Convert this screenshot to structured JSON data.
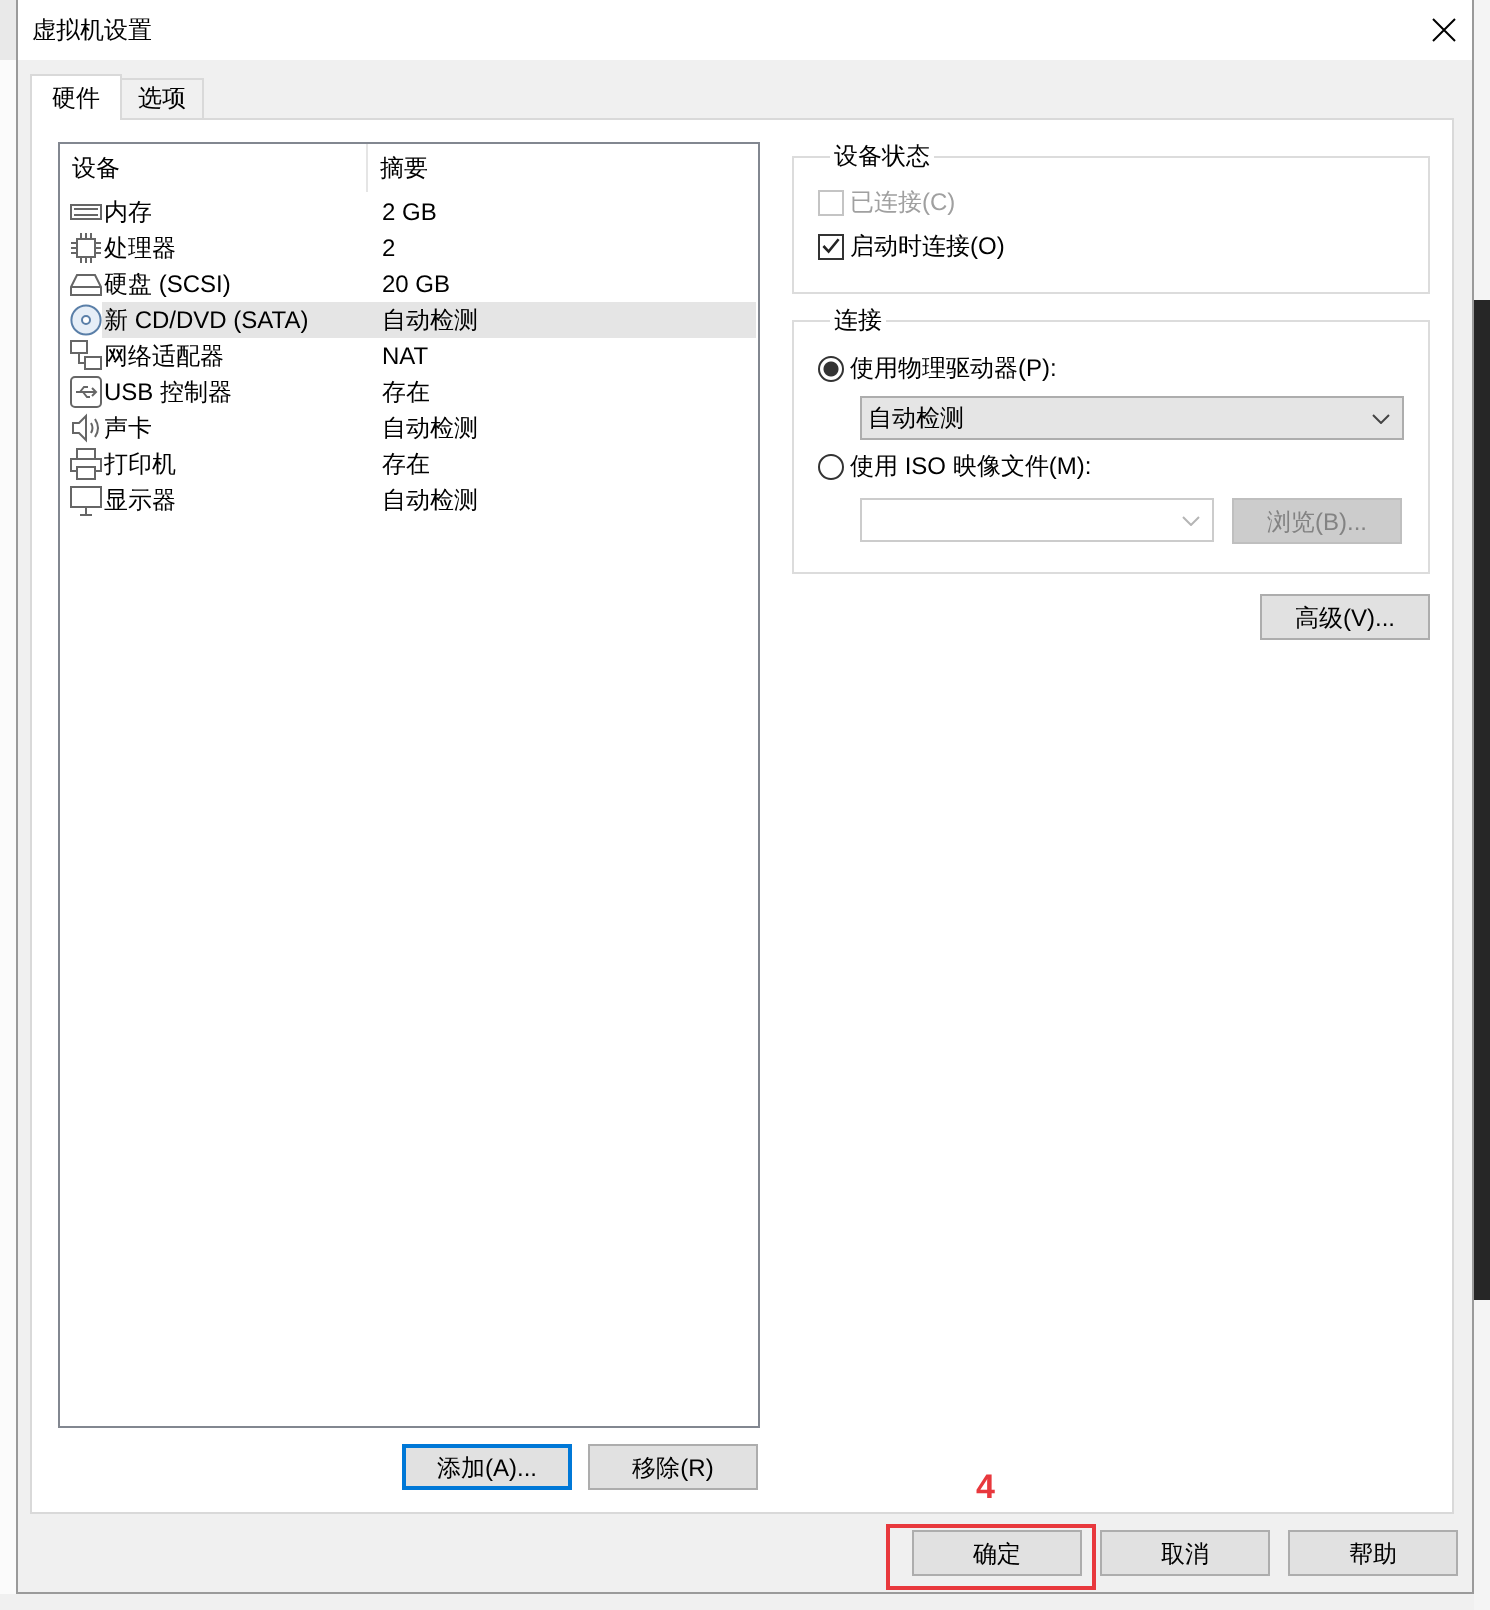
{
  "window": {
    "title": "虚拟机设置"
  },
  "tabs": [
    {
      "label": "硬件",
      "selected": true
    },
    {
      "label": "选项",
      "selected": false
    }
  ],
  "device_list": {
    "columns": [
      "设备",
      "摘要"
    ],
    "rows": [
      {
        "kind": "memory",
        "device": "内存",
        "summary": "2 GB",
        "selected": false
      },
      {
        "kind": "processor",
        "device": "处理器",
        "summary": "2",
        "selected": false
      },
      {
        "kind": "hard_disk",
        "device": "硬盘 (SCSI)",
        "summary": "20 GB",
        "selected": false
      },
      {
        "kind": "cd_dvd",
        "device": "新 CD/DVD (SATA)",
        "summary": "自动检测",
        "selected": true
      },
      {
        "kind": "network",
        "device": "网络适配器",
        "summary": "NAT",
        "selected": false
      },
      {
        "kind": "usb",
        "device": "USB 控制器",
        "summary": "存在",
        "selected": false
      },
      {
        "kind": "sound",
        "device": "声卡",
        "summary": "自动检测",
        "selected": false
      },
      {
        "kind": "printer",
        "device": "打印机",
        "summary": "存在",
        "selected": false
      },
      {
        "kind": "display",
        "device": "显示器",
        "summary": "自动检测",
        "selected": false
      }
    ]
  },
  "list_buttons": [
    {
      "label": "添加(A)...",
      "focused": true
    },
    {
      "label": "移除(R)",
      "focused": false
    }
  ],
  "device_status": {
    "title": "设备状态",
    "options": [
      {
        "label": "已连接(C)",
        "checked": false,
        "disabled": true
      },
      {
        "label": "启动时连接(O)",
        "checked": true,
        "disabled": false
      }
    ]
  },
  "connection": {
    "title": "连接",
    "physical_drive": {
      "label": "使用物理驱动器(P):",
      "selected": true,
      "dropdown": {
        "value": "自动检测",
        "disabled": false
      }
    },
    "iso_image": {
      "label": "使用 ISO 映像文件(M):",
      "selected": false,
      "file_field": {
        "disabled": true
      },
      "browse_button": {
        "label": "浏览(B)...",
        "disabled": true
      }
    }
  },
  "advanced_button": {
    "label": "高级(V)..."
  },
  "dialog_buttons": [
    {
      "label": "确定",
      "annotation": "4"
    },
    {
      "label": "取消"
    },
    {
      "label": "帮助"
    }
  ]
}
